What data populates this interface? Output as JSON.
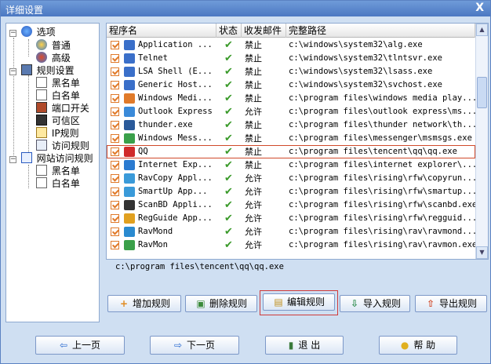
{
  "window": {
    "title": "详细设置",
    "close_glyph": "X"
  },
  "tree": {
    "nodes": [
      {
        "label": "选项",
        "icon": "options-icon"
      },
      {
        "label": "普通",
        "icon": "gear-icon"
      },
      {
        "label": "高级",
        "icon": "gear-icon"
      },
      {
        "label": "规则设置",
        "icon": "rules-icon"
      },
      {
        "label": "黑名单",
        "icon": "page-icon"
      },
      {
        "label": "白名单",
        "icon": "page-icon"
      },
      {
        "label": "端口开关",
        "icon": "port-icon"
      },
      {
        "label": "可信区",
        "icon": "trusted-icon"
      },
      {
        "label": "IP规则",
        "icon": "ip-icon"
      },
      {
        "label": "访问规则",
        "icon": "exe-icon"
      },
      {
        "label": "网站访问规则",
        "icon": "web-icon"
      },
      {
        "label": "黑名单",
        "icon": "page-icon"
      },
      {
        "label": "白名单",
        "icon": "page-icon"
      }
    ]
  },
  "list": {
    "columns": [
      "程序名",
      "状态",
      "收发邮件",
      "完整路径"
    ],
    "rows": [
      {
        "name": "Application ...",
        "status": "✔",
        "mail": "禁止",
        "path": "c:\\windows\\system32\\alg.exe",
        "color": "#3a6fc9"
      },
      {
        "name": "Telnet",
        "status": "✔",
        "mail": "禁止",
        "path": "c:\\windows\\system32\\tlntsvr.exe",
        "color": "#3a6fc9"
      },
      {
        "name": "LSA Shell (E...",
        "status": "✔",
        "mail": "禁止",
        "path": "c:\\windows\\system32\\lsass.exe",
        "color": "#3a6fc9"
      },
      {
        "name": "Generic Host...",
        "status": "✔",
        "mail": "禁止",
        "path": "c:\\windows\\system32\\svchost.exe",
        "color": "#3a6fc9"
      },
      {
        "name": "Windows Medi...",
        "status": "✔",
        "mail": "禁止",
        "path": "c:\\program files\\windows media play...",
        "color": "#e07a2a"
      },
      {
        "name": "Outlook Express",
        "status": "✔",
        "mail": "允许",
        "path": "c:\\program files\\outlook express\\ms...",
        "color": "#3a8ad9"
      },
      {
        "name": "thunder.exe",
        "status": "✔",
        "mail": "禁止",
        "path": "c:\\program files\\thunder network\\th...",
        "color": "#2a5a9a"
      },
      {
        "name": "Windows Mess...",
        "status": "✔",
        "mail": "禁止",
        "path": "c:\\program files\\messenger\\msmsgs.exe",
        "color": "#3aa04a"
      },
      {
        "name": "QQ",
        "status": "✔",
        "mail": "禁止",
        "path": "c:\\program files\\tencent\\qq\\qq.exe",
        "color": "#d02a2a"
      },
      {
        "name": "Internet Exp...",
        "status": "✔",
        "mail": "禁止",
        "path": "c:\\program files\\internet explorer\\...",
        "color": "#2a7ad0"
      },
      {
        "name": "RavCopy Appl...",
        "status": "✔",
        "mail": "允许",
        "path": "c:\\program files\\rising\\rfw\\copyrun...",
        "color": "#3a9ad9"
      },
      {
        "name": "SmartUp  App...",
        "status": "✔",
        "mail": "允许",
        "path": "c:\\program files\\rising\\rfw\\smartup...",
        "color": "#3a9ad9"
      },
      {
        "name": "ScanBD Appli...",
        "status": "✔",
        "mail": "允许",
        "path": "c:\\program files\\rising\\rfw\\scanbd.exe",
        "color": "#333333"
      },
      {
        "name": "RegGuide App...",
        "status": "✔",
        "mail": "允许",
        "path": "c:\\program files\\rising\\rfw\\regguid...",
        "color": "#e0a020"
      },
      {
        "name": "RavMond",
        "status": "✔",
        "mail": "允许",
        "path": "c:\\program files\\rising\\rav\\ravmond...",
        "color": "#2a8ad0"
      },
      {
        "name": "RavMon",
        "status": "✔",
        "mail": "允许",
        "path": "c:\\program files\\rising\\rav\\ravmon.exe",
        "color": "#3aa04a"
      }
    ],
    "selected_path": "c:\\program files\\tencent\\qq\\qq.exe"
  },
  "actions": {
    "add": "增加规则",
    "delete": "删除规则",
    "edit": "编辑规则",
    "import": "导入规则",
    "export": "导出规则"
  },
  "nav": {
    "prev": "上一页",
    "next": "下一页",
    "exit": "退 出",
    "help": "帮 助"
  }
}
